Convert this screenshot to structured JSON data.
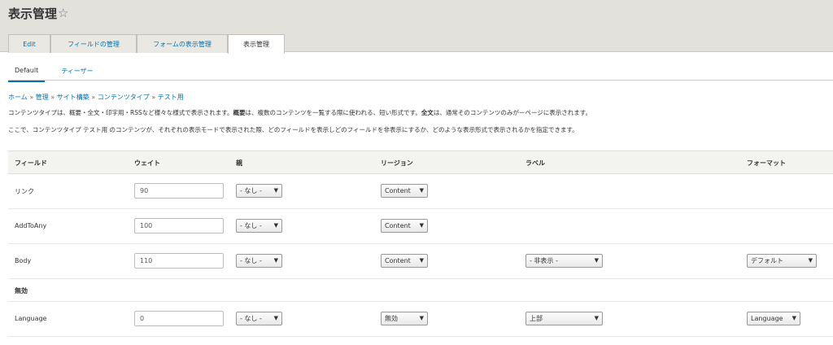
{
  "page": {
    "title": "表示管理"
  },
  "tabs": [
    "Edit",
    "フィールドの管理",
    "フォームの表示管理",
    "表示管理"
  ],
  "subtabs": [
    "Default",
    "ティーザー"
  ],
  "breadcrumb": [
    "ホーム",
    "管理",
    "サイト構築",
    "コンテンツタイプ",
    "テスト用"
  ],
  "breadcrumb_sep": "»",
  "description": {
    "line1_a": "コンテンツタイプは、概要・全文・印字用・RSSなど様々な様式で表示されます。",
    "line1_b": "概要",
    "line1_c": "は、複数のコンテンツを一覧する際に使われる、短い形式です。",
    "line1_d": "全文",
    "line1_e": "は、通常そのコンテンツのみがーページに表示されます。",
    "line2": "ここで、コンテンツタイプ テスト用 のコンテンツが、それぞれの表示モードで表示された際、どのフィールドを表示しどのフィールドを非表示にするか、どのような表示形式で表示されるかを指定できます。"
  },
  "table": {
    "headers": [
      "フィールド",
      "ウェイト",
      "親",
      "リージョン",
      "ラベル",
      "フォーマット"
    ],
    "rows": [
      {
        "field": "リンク",
        "weight": "90",
        "parent": "- なし -",
        "region": "Content",
        "label": "",
        "format": ""
      },
      {
        "field": "AddToAny",
        "weight": "100",
        "parent": "- なし -",
        "region": "Content",
        "label": "",
        "format": ""
      },
      {
        "field": "Body",
        "weight": "110",
        "parent": "- なし -",
        "region": "Content",
        "label": "- 非表示 -",
        "format": "デフォルト"
      }
    ],
    "section": "無効",
    "disabled_rows": [
      {
        "field": "Language",
        "weight": "0",
        "parent": "- なし -",
        "region": "無効",
        "label": "上部",
        "format": "Language"
      }
    ]
  },
  "icons": {
    "favorite": "star-outline-icon",
    "dropdown": "caret-down-icon"
  },
  "colors": {
    "link": "#0071b3",
    "header_bg": "#e2e1dc"
  }
}
